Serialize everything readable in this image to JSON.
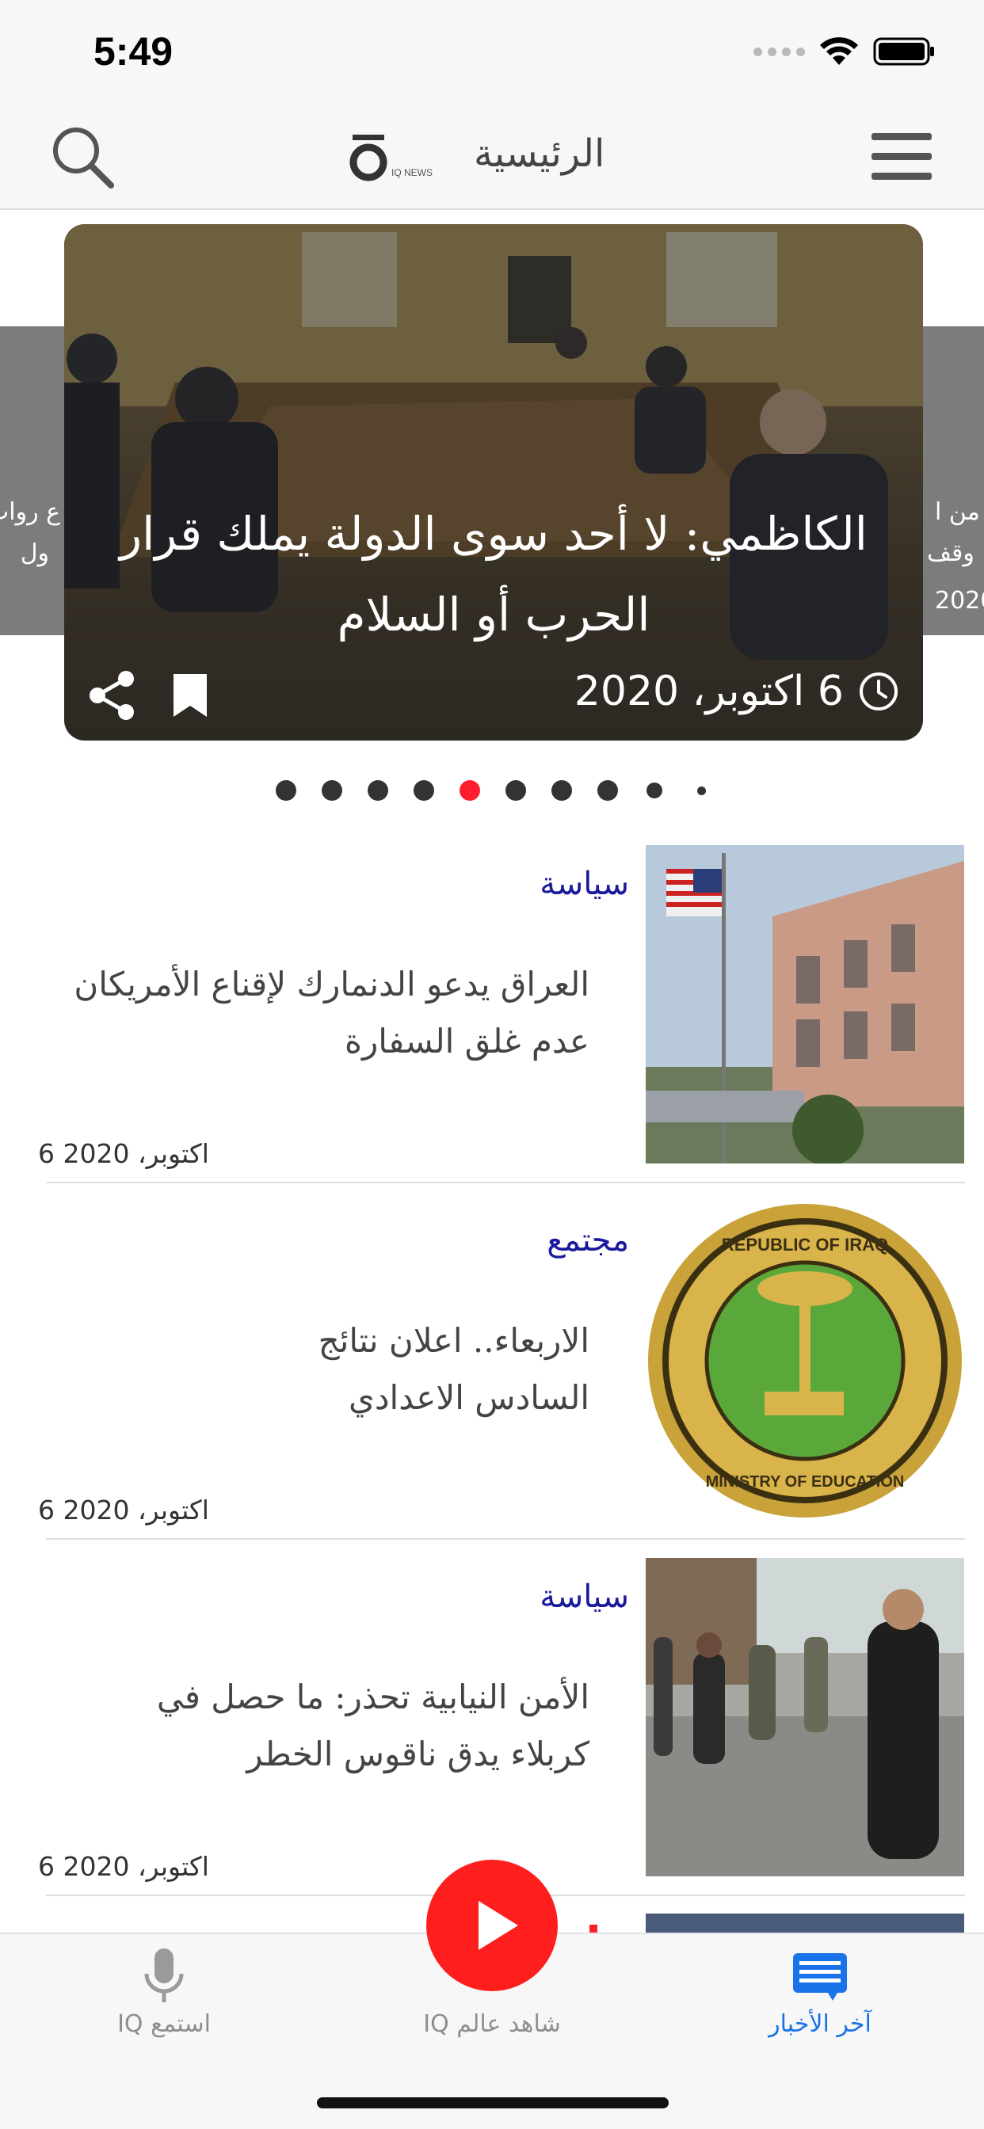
{
  "status_bar": {
    "time": "5:49"
  },
  "header": {
    "title": "الرئيسية",
    "logo_text": "IQ NEWS"
  },
  "carousel": {
    "left_peek_lines": [
      "ع روات",
      "ول"
    ],
    "right_peek_lines": [
      "من ا",
      "وقف",
      "2020"
    ],
    "featured": {
      "title": "الكاظمي: لا أحد سوى الدولة يملك قرار الحرب أو السلام",
      "date": "6 اكتوبر، 2020"
    },
    "page_count": 10,
    "active_page": 5
  },
  "news": [
    {
      "category": "سياسة",
      "headline": "العراق يدعو الدنمارك  لإقناع الأمريكان عدم غلق السفارة",
      "date": "6 اكتوبر، 2020",
      "image": "embassy-photo"
    },
    {
      "category": "مجتمع",
      "headline": "الاربعاء.. اعلان نتائج السادس الاعدادي",
      "date": "6 اكتوبر، 2020",
      "image": "ministry-of-education-seal",
      "seal_text_top": "REPUBLIC OF IRAQ",
      "seal_text_bottom": "MINISTRY OF EDUCATION"
    },
    {
      "category": "سياسة",
      "headline": "الأمن النيابية تحذر: ما حصل في كربلاء يدق ناقوس الخطر",
      "date": "6 اكتوبر، 2020",
      "image": "crowd-photo"
    }
  ],
  "tabbar": {
    "tabs": [
      {
        "label": "استمع IQ",
        "icon": "microphone-icon",
        "active": false
      },
      {
        "label": "شاهد عالم IQ",
        "icon": "play-icon",
        "active": false
      },
      {
        "label": "آخر الأخبار",
        "icon": "news-list-icon",
        "active": true
      }
    ]
  },
  "colors": {
    "accent": "#ff1e2d",
    "active_tab": "#1a73e8",
    "category": "#1a1a9c"
  }
}
